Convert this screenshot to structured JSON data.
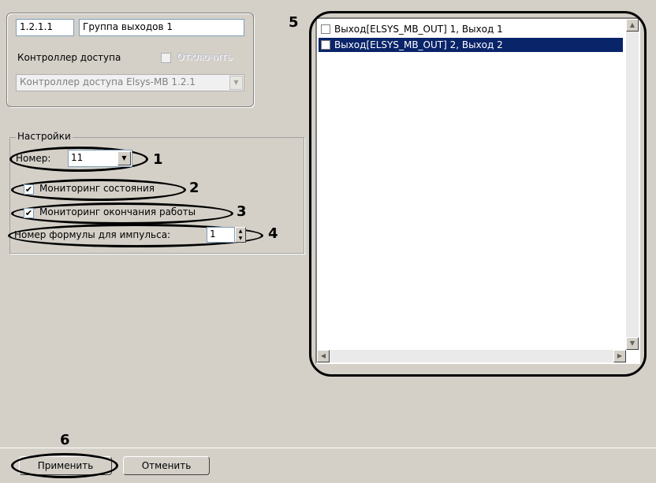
{
  "object": {
    "id": "1.2.1.1",
    "name": "Группа выходов 1",
    "parent_label": "Контроллер доступа",
    "disable_label": "Отключить",
    "parent_value": "Контроллер доступа Elsys-MB 1.2.1"
  },
  "settings": {
    "group_title": "Настройки",
    "number_label": "Номер:",
    "number_value": "11",
    "monitoring_state_label": "Мониторинг состояния",
    "monitoring_end_label": "Мониторинг окончания работы",
    "formula_label": "Номер формулы для импульса:",
    "formula_value": "1"
  },
  "outputs_list": [
    {
      "label": "Выход[ELSYS_MB_OUT] 1, Выход 1",
      "selected": false
    },
    {
      "label": "Выход[ELSYS_MB_OUT] 2, Выход 2",
      "selected": true
    }
  ],
  "callouts": [
    "1",
    "2",
    "3",
    "4",
    "5",
    "6"
  ],
  "buttons": {
    "apply": "Применить",
    "cancel": "Отменить"
  },
  "colors": {
    "selection": "#0a246a",
    "panel": "#d4d0c8"
  }
}
